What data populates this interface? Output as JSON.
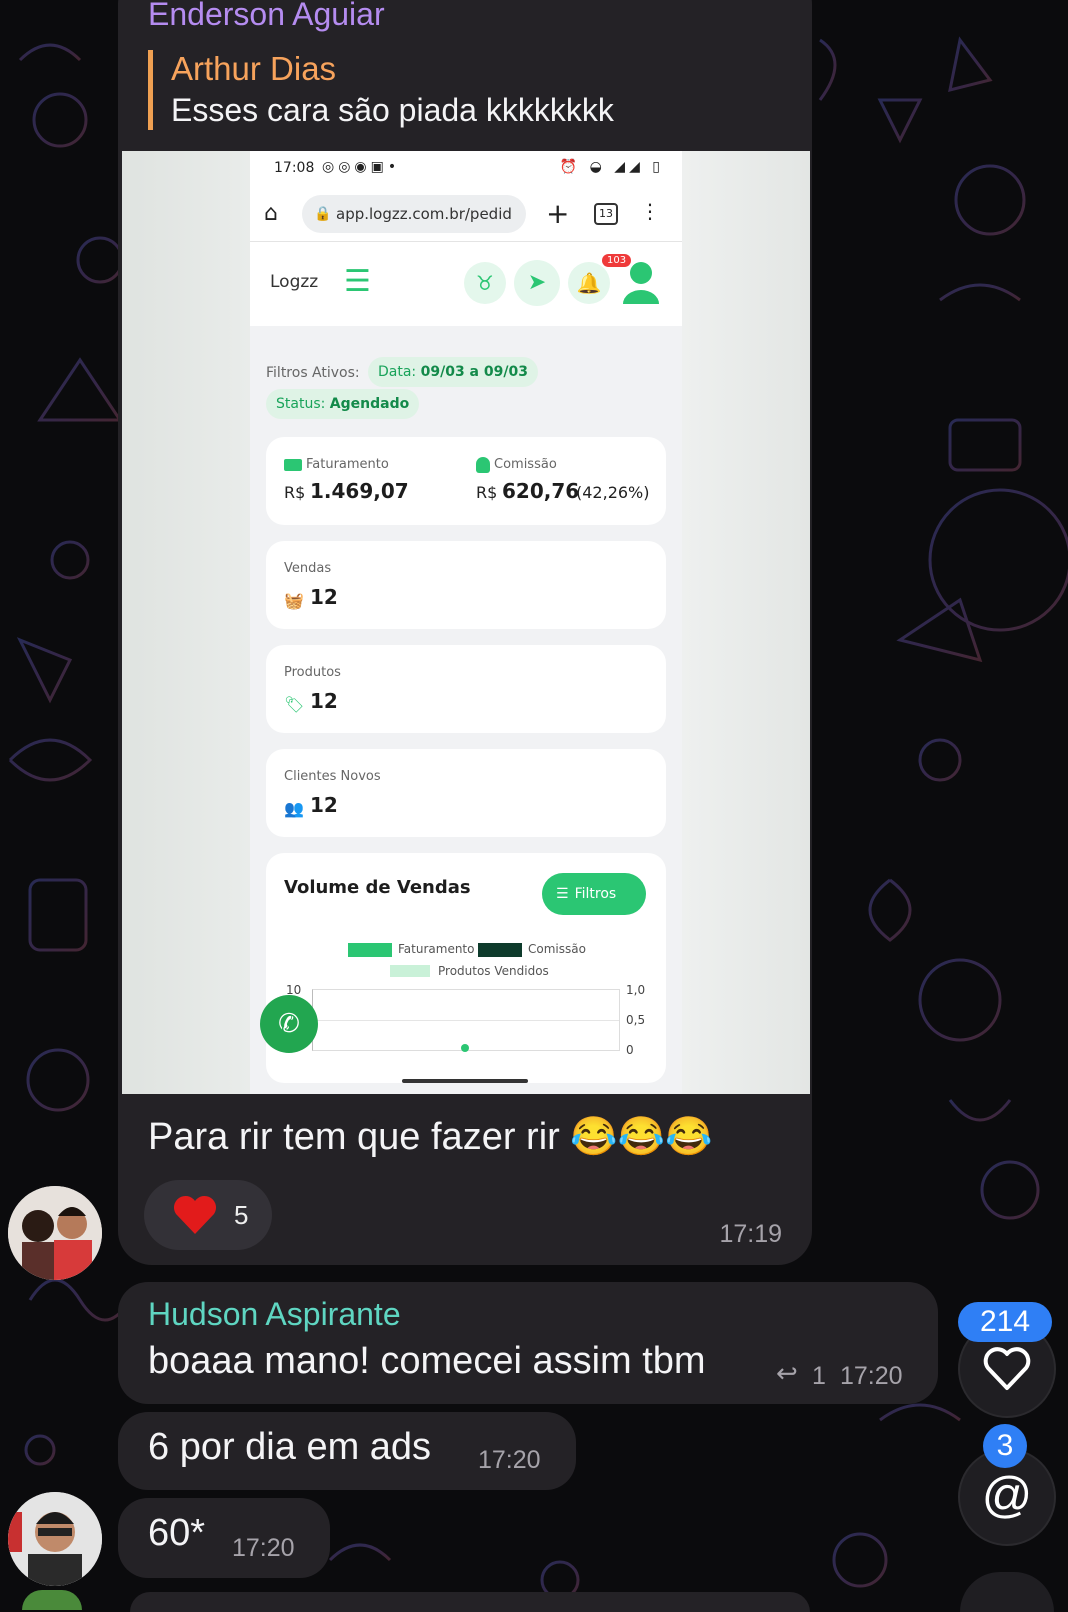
{
  "message1": {
    "sender": "Enderson Aguiar",
    "reply_to_name": "Arthur Dias",
    "reply_to_text": "Esses cara são piada kkkkkkkk",
    "text": "Para rir tem que fazer rir 😂😂😂",
    "reaction_emoji": "❤️",
    "reaction_count": "5",
    "time": "17:19"
  },
  "screenshot": {
    "status_time": "17:08",
    "url": "app.logzz.com.br/pedid",
    "tabs_count": "13",
    "logo": "Logzz",
    "notif_count": "103",
    "filters_label": "Filtros Ativos:",
    "filter_date_label": "Data:",
    "filter_date_value": "09/03 a 09/03",
    "filter_status_label": "Status:",
    "filter_status_value": "Agendado",
    "faturamento_label": "Faturamento",
    "faturamento_currency": "R$",
    "faturamento_value": "1.469,07",
    "comissao_label": "Comissão",
    "comissao_currency": "R$",
    "comissao_value": "620,76",
    "comissao_pct": "(42,26%)",
    "vendas_label": "Vendas",
    "vendas_value": "12",
    "produtos_label": "Produtos",
    "produtos_value": "12",
    "clientes_label": "Clientes Novos",
    "clientes_value": "12",
    "volume_title": "Volume de Vendas",
    "filtros_button": "Filtros",
    "legend_faturamento": "Faturamento",
    "legend_comissao": "Comissão",
    "legend_produtos": "Produtos Vendidos",
    "axis_left_top": "10",
    "axis_right_top": "1,0",
    "axis_right_mid": "0,5",
    "axis_right_bottom": "0",
    "colors": {
      "green": "#2bc673",
      "dark_green": "#0e3b2c",
      "light_green": "#c9f1d8"
    }
  },
  "message2": {
    "sender": "Hudson Aspirante",
    "text": "boaaa mano! comecei assim tbm",
    "reply_count": "1",
    "time": "17:20"
  },
  "message3": {
    "text": "6 por dia em ads",
    "time": "17:20"
  },
  "message4": {
    "text": "60*",
    "time": "17:20"
  },
  "side": {
    "reactions_badge": "214",
    "mentions_badge": "3",
    "heart_icon": "heart-icon",
    "mention_icon": "at-icon"
  },
  "colors": {
    "bubble": "#242226",
    "sender1": "#b58cf0",
    "sender2": "#5fd6c2",
    "quote_accent": "#f7a35c",
    "badge": "#2f7ff5"
  }
}
